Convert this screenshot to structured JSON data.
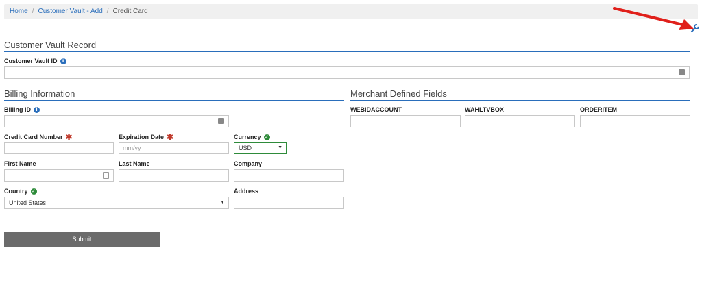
{
  "breadcrumb": {
    "home": "Home",
    "vault": "Customer Vault - Add",
    "current": "Credit Card"
  },
  "vault_section": {
    "title": "Customer Vault Record",
    "id_label": "Customer Vault ID"
  },
  "billing": {
    "title": "Billing Information",
    "billing_id_label": "Billing ID",
    "cc_label": "Credit Card Number",
    "exp_label": "Expiration Date",
    "exp_placeholder": "mm/yy",
    "currency_label": "Currency",
    "currency_value": "USD",
    "first_name_label": "First Name",
    "last_name_label": "Last Name",
    "company_label": "Company",
    "country_label": "Country",
    "country_value": "United States",
    "address_label": "Address"
  },
  "merchant": {
    "title": "Merchant Defined Fields",
    "field1": "WEBIDACCOUNT",
    "field2": "WAHLTVBOX",
    "field3": "ORDERITEM"
  },
  "submit_label": "Submit",
  "colors": {
    "accent": "#2a6ebb",
    "required": "#c0392b",
    "valid": "#2e8b3a",
    "button": "#6b6b6b",
    "arrow": "#e0201b"
  },
  "icons": [
    "wrench-icon",
    "info-icon",
    "check-icon",
    "required-asterisk",
    "keyboard-icon",
    "dropdown-caret-icon",
    "red-arrow"
  ]
}
